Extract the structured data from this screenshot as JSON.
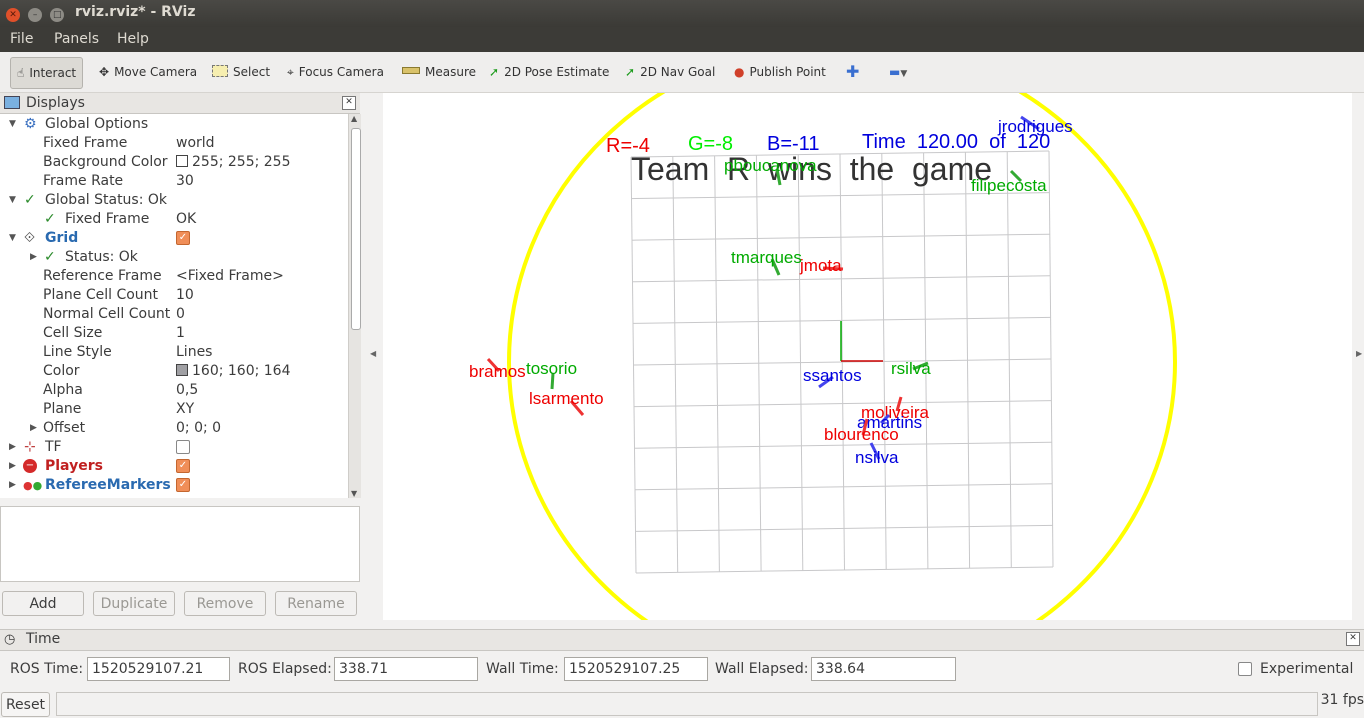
{
  "window": {
    "title": "rviz.rviz* - RViz"
  },
  "menu": [
    "File",
    "Panels",
    "Help"
  ],
  "toolbar": {
    "interact": "Interact",
    "move_camera": "Move Camera",
    "select": "Select",
    "focus_camera": "Focus Camera",
    "measure": "Measure",
    "pose_estimate": "2D Pose Estimate",
    "nav_goal": "2D Nav Goal",
    "publish_point": "Publish Point"
  },
  "displays": {
    "title": "Displays",
    "rows": [
      {
        "name": "Global Options",
        "value": ""
      },
      {
        "name": "Fixed Frame",
        "value": "world"
      },
      {
        "name": "Background Color",
        "value": "255; 255; 255",
        "swatch": "#ffffff"
      },
      {
        "name": "Frame Rate",
        "value": "30"
      },
      {
        "name": "Global Status: Ok",
        "value": ""
      },
      {
        "name": "Fixed Frame",
        "value": "OK"
      },
      {
        "name": "Grid",
        "value": ""
      },
      {
        "name": "Status: Ok",
        "value": ""
      },
      {
        "name": "Reference Frame",
        "value": "<Fixed Frame>"
      },
      {
        "name": "Plane Cell Count",
        "value": "10"
      },
      {
        "name": "Normal Cell Count",
        "value": "0"
      },
      {
        "name": "Cell Size",
        "value": "1"
      },
      {
        "name": "Line Style",
        "value": "Lines"
      },
      {
        "name": "Color",
        "value": "160; 160; 164",
        "swatch": "#a0a0a4"
      },
      {
        "name": "Alpha",
        "value": "0,5"
      },
      {
        "name": "Plane",
        "value": "XY"
      },
      {
        "name": "Offset",
        "value": "0; 0; 0"
      },
      {
        "name": "TF",
        "value": ""
      },
      {
        "name": "Players",
        "value": ""
      },
      {
        "name": "RefereeMarkers",
        "value": ""
      }
    ],
    "buttons": {
      "add": "Add",
      "duplicate": "Duplicate",
      "remove": "Remove",
      "rename": "Rename"
    }
  },
  "scene": {
    "score_r": "R=-4",
    "score_g": "G=-8",
    "score_b": "B=-11",
    "time_label": "Time  120.00  of  120",
    "banner": "Team  R  wins  the  game",
    "players": [
      {
        "name": "jrodrigues",
        "color": "#0000dd"
      },
      {
        "name": "pboucanova",
        "color": "#00aa00"
      },
      {
        "name": "filipecosta",
        "color": "#00aa00"
      },
      {
        "name": "tmarques",
        "color": "#00aa00"
      },
      {
        "name": "jmota",
        "color": "#ee0000"
      },
      {
        "name": "bramos",
        "color": "#ee0000"
      },
      {
        "name": "tosorio",
        "color": "#00aa00"
      },
      {
        "name": "lsarmento",
        "color": "#ee0000"
      },
      {
        "name": "ssantos",
        "color": "#0000dd"
      },
      {
        "name": "rsilva",
        "color": "#00aa00"
      },
      {
        "name": "moliveira",
        "color": "#ee0000"
      },
      {
        "name": "amartins",
        "color": "#0000dd"
      },
      {
        "name": "blourenco",
        "color": "#ee0000"
      },
      {
        "name": "nsilva",
        "color": "#0000dd"
      }
    ]
  },
  "time_panel": {
    "title": "Time",
    "ros_time_label": "ROS Time:",
    "ros_time": "1520529107.21",
    "ros_elapsed_label": "ROS Elapsed:",
    "ros_elapsed": "338.71",
    "wall_time_label": "Wall Time:",
    "wall_time": "1520529107.25",
    "wall_elapsed_label": "Wall Elapsed:",
    "wall_elapsed": "338.64",
    "experimental": "Experimental"
  },
  "status": {
    "reset": "Reset",
    "fps": "31 fps"
  }
}
